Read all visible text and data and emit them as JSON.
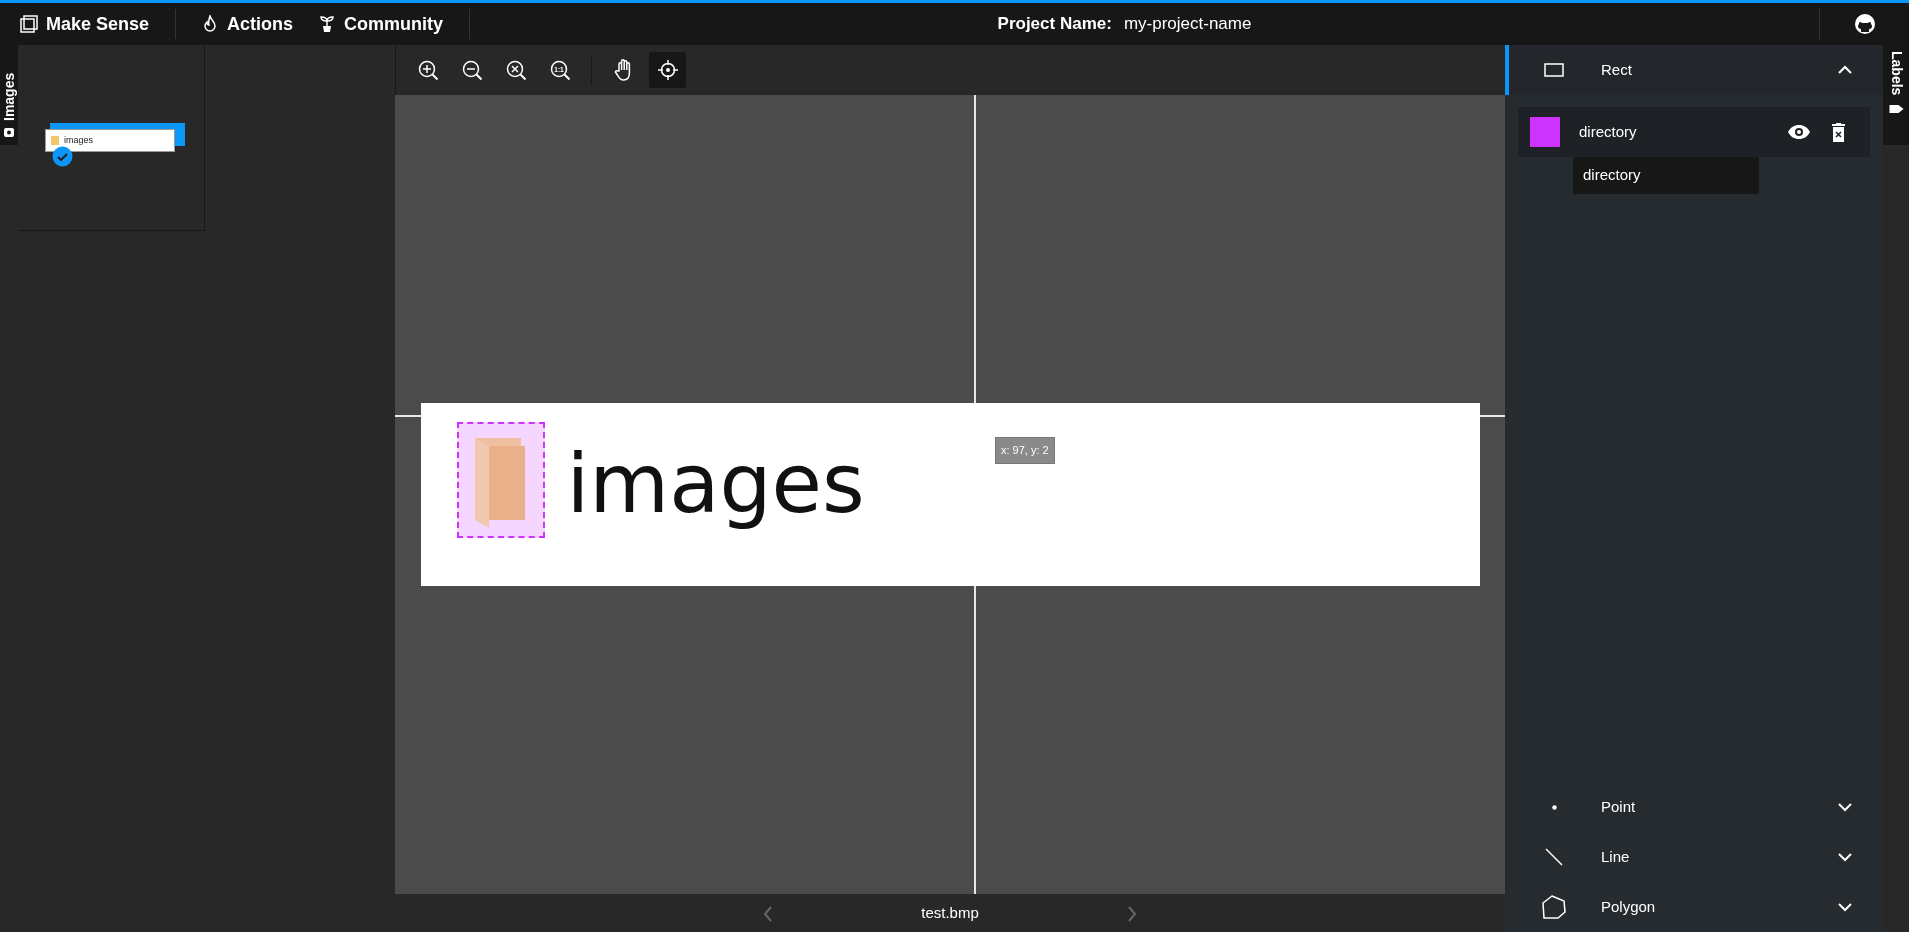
{
  "header": {
    "brand": "Make Sense",
    "menu": [
      {
        "kind": "actions",
        "label": "Actions"
      },
      {
        "kind": "community",
        "label": "Community"
      }
    ],
    "project_label": "Project Name:",
    "project_name": "my-project-name"
  },
  "left_tab": {
    "label": "Images"
  },
  "thumbnails": [
    {
      "caption": "images",
      "checked": true
    }
  ],
  "toolbar": [
    {
      "kind": "zoom-in",
      "selected": false
    },
    {
      "kind": "zoom-out",
      "selected": false
    },
    {
      "kind": "zoom-fit",
      "selected": false
    },
    {
      "kind": "zoom-actual",
      "text": "1:1",
      "selected": false
    },
    {
      "kind": "divider"
    },
    {
      "kind": "hand",
      "selected": false
    },
    {
      "kind": "crosshair",
      "selected": true
    }
  ],
  "canvas": {
    "image_text": "images",
    "cursor_readout": "x: 97, y: 2"
  },
  "footer": {
    "file_name": "test.bmp"
  },
  "right_tab": {
    "label": "Labels"
  },
  "sections": [
    {
      "kind": "rect",
      "title": "Rect",
      "expanded": true,
      "labels": [
        {
          "name": "directory",
          "color": "#cc33ff"
        }
      ],
      "options": [
        "directory"
      ]
    },
    {
      "kind": "point",
      "title": "Point",
      "expanded": false
    },
    {
      "kind": "line",
      "title": "Line",
      "expanded": false
    },
    {
      "kind": "polygon",
      "title": "Polygon",
      "expanded": false
    }
  ]
}
